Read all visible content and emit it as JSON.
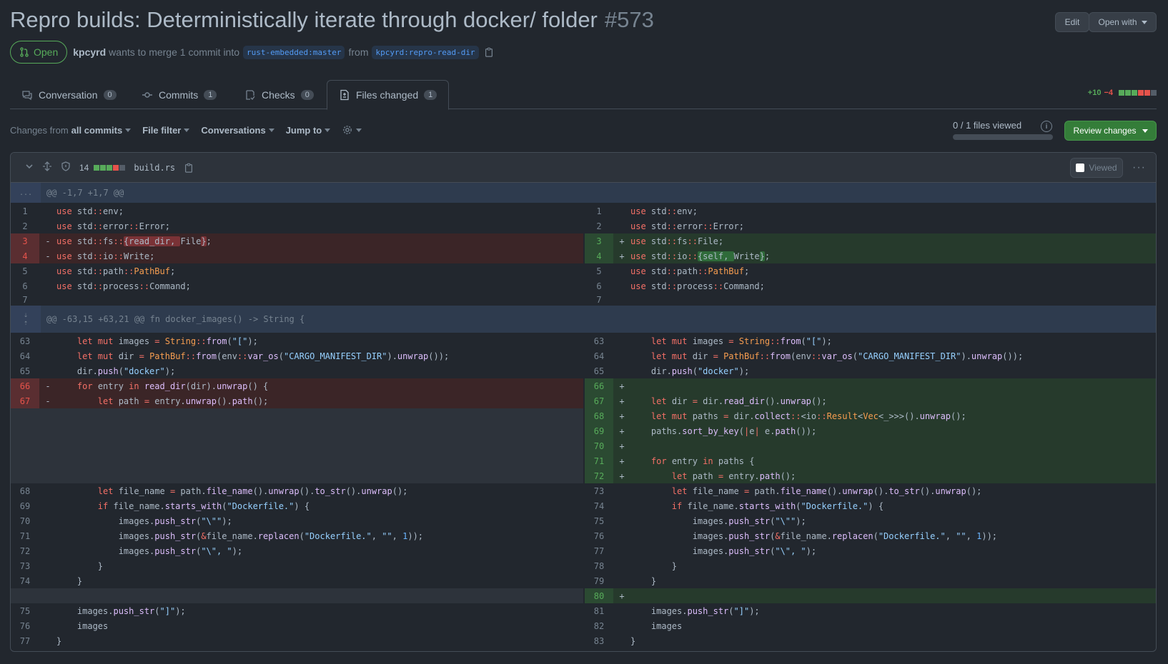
{
  "header": {
    "title": "Repro builds: Deterministically iterate through docker/ folder",
    "number": "#573",
    "edit_label": "Edit",
    "open_with_label": "Open with"
  },
  "meta": {
    "state": "Open",
    "author": "kpcyrd",
    "merge_text": "wants to merge 1 commit into",
    "base_branch": "rust-embedded:master",
    "from_text": "from",
    "head_branch": "kpcyrd:repro-read-dir"
  },
  "tabs": [
    {
      "label": "Conversation",
      "count": "0"
    },
    {
      "label": "Commits",
      "count": "1"
    },
    {
      "label": "Checks",
      "count": "0"
    },
    {
      "label": "Files changed",
      "count": "1"
    }
  ],
  "diffstat": {
    "additions": "+10",
    "deletions": "−4",
    "add_color": "#57ab5a",
    "del_color": "#e5534b"
  },
  "toolbar": {
    "changes_from": "Changes from",
    "changes_from_value": "all commits",
    "file_filter": "File filter",
    "conversations": "Conversations",
    "jump_to": "Jump to",
    "files_viewed": "0 / 1 files viewed",
    "review_label": "Review changes"
  },
  "file": {
    "changes": "14",
    "name": "build.rs",
    "viewed_label": "Viewed"
  },
  "hunks": [
    {
      "expander": "...",
      "header": "@@ -1,7 +1,7 @@"
    },
    {
      "expander": "",
      "header": "@@ -63,15 +63,21 @@ fn docker_images() -> String {"
    }
  ]
}
